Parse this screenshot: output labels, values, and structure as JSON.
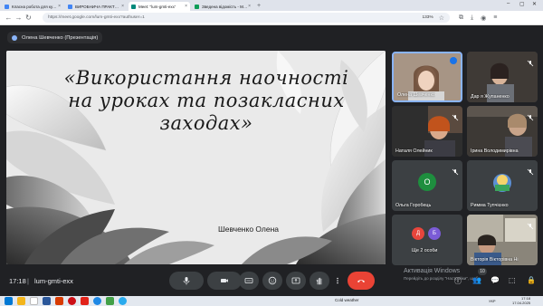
{
  "browser": {
    "tabs": [
      {
        "label": "Класна робота для курсу \"ВИР",
        "fav_color": "#4285f4",
        "active": false
      },
      {
        "label": "ВИРОБНИЧА ПРАКТИКА В ЗО",
        "fav_color": "#4285f4",
        "active": false
      },
      {
        "label": "Meet: \"lum-gmti-exx\"",
        "fav_color": "#00897b",
        "active": true
      },
      {
        "label": "Зведена відомість - МАСИМ",
        "fav_color": "#0f9d58",
        "active": false
      }
    ],
    "new_tab": "+",
    "url": "https://meet.google.com/lum-gmti-exx?authuser=1",
    "url_domain": "meet.google.com",
    "zoom": "133%"
  },
  "meeting": {
    "presenter_label": "Олена Шевченко (Презентація)",
    "time": "17:18",
    "separator": "|",
    "code": "lum-gmti-exx",
    "participant_count": "10"
  },
  "slide": {
    "title": "«Використання наочності на уроках та позакласних заходах»",
    "author": "Шевченко Олена"
  },
  "participants": [
    {
      "name": "Олена Шевченко",
      "kind": "video",
      "speaking": true
    },
    {
      "name": "Дар  я Жупаненко",
      "kind": "video"
    },
    {
      "name": "Наталя Олейник",
      "kind": "video"
    },
    {
      "name": "Ірина Володимирівна",
      "kind": "video"
    },
    {
      "name": "Ольга Горобець",
      "kind": "avatar",
      "initial": "О",
      "color": "#1e8e3e"
    },
    {
      "name": "Римма Тупчієнко",
      "kind": "video"
    },
    {
      "name": "Ще 2 особи",
      "kind": "group",
      "initials": [
        "Д",
        "Б"
      ],
      "colors": [
        "#e8453c",
        "#7b5cd6"
      ]
    },
    {
      "name": "Вікторія Вікторівна Ні",
      "kind": "video"
    }
  ],
  "windows": {
    "activate_title": "Активація Windows",
    "activate_sub": "Перейдіть до розділу \"Настройки\", щоб"
  },
  "taskbar": {
    "weather": "Cold weather",
    "lang": "УКР",
    "time": "17:18",
    "date": "17.04.2025"
  },
  "colors": {
    "hangup": "#ea4335",
    "active_border": "#8ab4f8",
    "speaking": "#1a73e8"
  }
}
